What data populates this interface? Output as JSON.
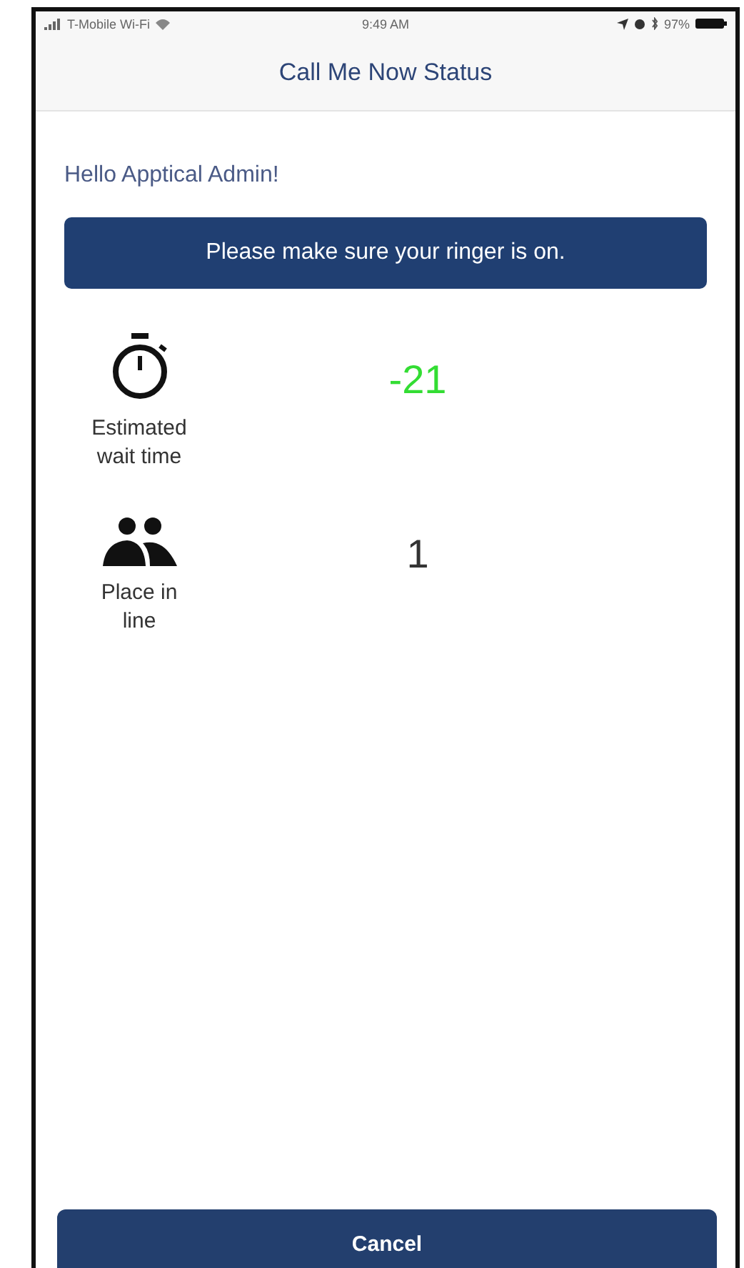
{
  "status_bar": {
    "carrier": "T-Mobile Wi-Fi",
    "time": "9:49 AM",
    "battery": "97%"
  },
  "nav_bar": {
    "title": "Call Me Now Status"
  },
  "greeting": "Hello Apptical Admin!",
  "notice": "Please make sure your ringer is on.",
  "stats": [
    {
      "kind": "stopwatch",
      "label": "Estimated wait time",
      "value": "-21",
      "color": "#33dd33"
    },
    {
      "kind": "people",
      "label": "Place in line",
      "value": "1",
      "color": "#333333"
    }
  ],
  "buttons": [
    {
      "label": "Cancel"
    }
  ]
}
